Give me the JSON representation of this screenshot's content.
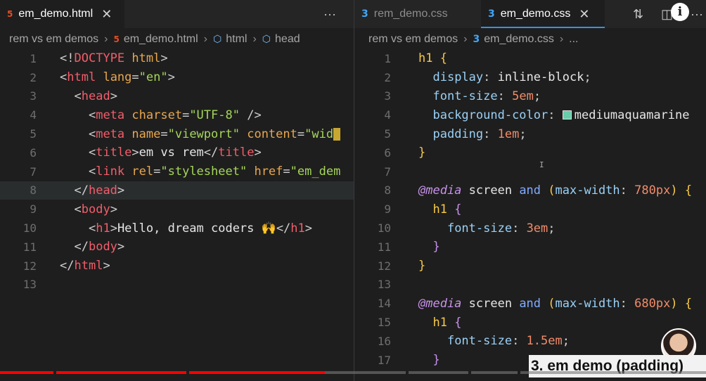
{
  "left": {
    "tab": {
      "title": "em_demo.html",
      "close_icon": "close-icon",
      "more_label": "···"
    },
    "breadcrumb": [
      "rem vs em demos",
      "em_demo.html",
      "html",
      "head"
    ],
    "current_line": 8,
    "lines": [
      {
        "n": "1",
        "tokens": [
          [
            "t-punct",
            "<!"
          ],
          [
            "t-tag",
            "DOCTYPE"
          ],
          [
            "t-text",
            " "
          ],
          [
            "t-attr",
            "html"
          ],
          [
            "t-punct",
            ">"
          ]
        ]
      },
      {
        "n": "2",
        "tokens": [
          [
            "t-punct",
            "<"
          ],
          [
            "t-tag",
            "html"
          ],
          [
            "t-text",
            " "
          ],
          [
            "t-attr",
            "lang"
          ],
          [
            "t-punct",
            "="
          ],
          [
            "t-str",
            "\"en\""
          ],
          [
            "t-punct",
            ">"
          ]
        ]
      },
      {
        "n": "3",
        "tokens": [
          [
            "t-text",
            "  "
          ],
          [
            "t-punct",
            "<"
          ],
          [
            "t-tag",
            "head"
          ],
          [
            "t-punct",
            ">"
          ]
        ]
      },
      {
        "n": "4",
        "tokens": [
          [
            "t-text",
            "    "
          ],
          [
            "t-punct",
            "<"
          ],
          [
            "t-tag",
            "meta"
          ],
          [
            "t-text",
            " "
          ],
          [
            "t-attr",
            "charset"
          ],
          [
            "t-punct",
            "="
          ],
          [
            "t-str",
            "\"UTF-8\""
          ],
          [
            "t-text",
            " "
          ],
          [
            "t-punct",
            "/>"
          ]
        ]
      },
      {
        "n": "5",
        "tokens": [
          [
            "t-text",
            "    "
          ],
          [
            "t-punct",
            "<"
          ],
          [
            "t-tag",
            "meta"
          ],
          [
            "t-text",
            " "
          ],
          [
            "t-attr",
            "name"
          ],
          [
            "t-punct",
            "="
          ],
          [
            "t-str",
            "\"viewport\""
          ],
          [
            "t-text",
            " "
          ],
          [
            "t-attr",
            "content"
          ],
          [
            "t-punct",
            "="
          ],
          [
            "t-str",
            "\"wid"
          ]
        ]
      },
      {
        "n": "6",
        "tokens": [
          [
            "t-text",
            "    "
          ],
          [
            "t-punct",
            "<"
          ],
          [
            "t-tag",
            "title"
          ],
          [
            "t-punct",
            ">"
          ],
          [
            "t-text",
            "em vs rem"
          ],
          [
            "t-punct",
            "</"
          ],
          [
            "t-tag",
            "title"
          ],
          [
            "t-punct",
            ">"
          ]
        ]
      },
      {
        "n": "7",
        "tokens": [
          [
            "t-text",
            "    "
          ],
          [
            "t-punct",
            "<"
          ],
          [
            "t-tag",
            "link"
          ],
          [
            "t-text",
            " "
          ],
          [
            "t-attr",
            "rel"
          ],
          [
            "t-punct",
            "="
          ],
          [
            "t-str",
            "\"stylesheet\""
          ],
          [
            "t-text",
            " "
          ],
          [
            "t-attr",
            "href"
          ],
          [
            "t-punct",
            "="
          ],
          [
            "t-str",
            "\"em_dem"
          ]
        ]
      },
      {
        "n": "8",
        "tokens": [
          [
            "t-text",
            "  "
          ],
          [
            "t-punct",
            "</"
          ],
          [
            "t-tag",
            "head"
          ],
          [
            "t-punct",
            ">"
          ]
        ]
      },
      {
        "n": "9",
        "tokens": [
          [
            "t-text",
            "  "
          ],
          [
            "t-punct",
            "<"
          ],
          [
            "t-tag",
            "body"
          ],
          [
            "t-punct",
            ">"
          ]
        ]
      },
      {
        "n": "10",
        "tokens": [
          [
            "t-text",
            "    "
          ],
          [
            "t-punct",
            "<"
          ],
          [
            "t-tag",
            "h1"
          ],
          [
            "t-punct",
            ">"
          ],
          [
            "t-text",
            "Hello, dream coders 🙌"
          ],
          [
            "t-punct",
            "</"
          ],
          [
            "t-tag",
            "h1"
          ],
          [
            "t-punct",
            ">"
          ]
        ]
      },
      {
        "n": "11",
        "tokens": [
          [
            "t-text",
            "  "
          ],
          [
            "t-punct",
            "</"
          ],
          [
            "t-tag",
            "body"
          ],
          [
            "t-punct",
            ">"
          ]
        ]
      },
      {
        "n": "12",
        "tokens": [
          [
            "t-punct",
            "</"
          ],
          [
            "t-tag",
            "html"
          ],
          [
            "t-punct",
            ">"
          ]
        ]
      },
      {
        "n": "13",
        "tokens": []
      }
    ]
  },
  "right": {
    "tabs": [
      {
        "title": "rem_demo.css",
        "active": false
      },
      {
        "title": "em_demo.css",
        "active": true,
        "close_icon": "close-icon"
      }
    ],
    "breadcrumb": [
      "rem vs em demos",
      "em_demo.css",
      "..."
    ],
    "swatch_color": "#66cdaa",
    "lines": [
      {
        "n": "1",
        "tokens": [
          [
            "t-sel",
            "h1"
          ],
          [
            "t-text",
            " "
          ],
          [
            "t-brace",
            "{"
          ]
        ]
      },
      {
        "n": "2",
        "tokens": [
          [
            "t-text",
            "  "
          ],
          [
            "t-prop",
            "display"
          ],
          [
            "t-punct",
            ": "
          ],
          [
            "t-val",
            "inline-block"
          ],
          [
            "t-punct",
            ";"
          ]
        ]
      },
      {
        "n": "3",
        "tokens": [
          [
            "t-text",
            "  "
          ],
          [
            "t-prop",
            "font-size"
          ],
          [
            "t-punct",
            ": "
          ],
          [
            "t-num",
            "5em"
          ],
          [
            "t-punct",
            ";"
          ]
        ]
      },
      {
        "n": "4",
        "tokens": [
          [
            "t-text",
            "  "
          ],
          [
            "t-prop",
            "background-color"
          ],
          [
            "t-punct",
            ": "
          ],
          [
            "swatch",
            ""
          ],
          [
            "t-val",
            "mediumaquamarine"
          ]
        ]
      },
      {
        "n": "5",
        "tokens": [
          [
            "t-text",
            "  "
          ],
          [
            "t-prop",
            "padding"
          ],
          [
            "t-punct",
            ": "
          ],
          [
            "t-num",
            "1em"
          ],
          [
            "t-punct",
            ";"
          ]
        ]
      },
      {
        "n": "6",
        "tokens": [
          [
            "t-brace",
            "}"
          ]
        ]
      },
      {
        "n": "7",
        "tokens": []
      },
      {
        "n": "8",
        "tokens": [
          [
            "t-kw",
            "@media"
          ],
          [
            "t-text",
            " screen "
          ],
          [
            "t-and",
            "and"
          ],
          [
            "t-text",
            " "
          ],
          [
            "t-brace",
            "("
          ],
          [
            "t-prop",
            "max-width"
          ],
          [
            "t-punct",
            ": "
          ],
          [
            "t-num",
            "780px"
          ],
          [
            "t-brace",
            ")"
          ],
          [
            "t-text",
            " "
          ],
          [
            "t-brace",
            "{"
          ]
        ]
      },
      {
        "n": "9",
        "tokens": [
          [
            "t-text",
            "  "
          ],
          [
            "t-sel",
            "h1"
          ],
          [
            "t-text",
            " "
          ],
          [
            "t-brace2",
            "{"
          ]
        ]
      },
      {
        "n": "10",
        "tokens": [
          [
            "t-text",
            "    "
          ],
          [
            "t-prop",
            "font-size"
          ],
          [
            "t-punct",
            ": "
          ],
          [
            "t-num",
            "3em"
          ],
          [
            "t-punct",
            ";"
          ]
        ]
      },
      {
        "n": "11",
        "tokens": [
          [
            "t-text",
            "  "
          ],
          [
            "t-brace2",
            "}"
          ]
        ]
      },
      {
        "n": "12",
        "tokens": [
          [
            "t-brace",
            "}"
          ]
        ]
      },
      {
        "n": "13",
        "tokens": []
      },
      {
        "n": "14",
        "tokens": [
          [
            "t-kw",
            "@media"
          ],
          [
            "t-text",
            " screen "
          ],
          [
            "t-and",
            "and"
          ],
          [
            "t-text",
            " "
          ],
          [
            "t-brace",
            "("
          ],
          [
            "t-prop",
            "max-width"
          ],
          [
            "t-punct",
            ": "
          ],
          [
            "t-num",
            "680px"
          ],
          [
            "t-brace",
            ")"
          ],
          [
            "t-text",
            " "
          ],
          [
            "t-brace",
            "{"
          ]
        ]
      },
      {
        "n": "15",
        "tokens": [
          [
            "t-text",
            "  "
          ],
          [
            "t-sel",
            "h1"
          ],
          [
            "t-text",
            " "
          ],
          [
            "t-brace2",
            "{"
          ]
        ]
      },
      {
        "n": "16",
        "tokens": [
          [
            "t-text",
            "    "
          ],
          [
            "t-prop",
            "font-size"
          ],
          [
            "t-punct",
            ": "
          ],
          [
            "t-num",
            "1.5em"
          ],
          [
            "t-punct",
            ";"
          ]
        ]
      },
      {
        "n": "17",
        "tokens": [
          [
            "t-text",
            "  "
          ],
          [
            "t-brace2",
            "}"
          ]
        ]
      }
    ]
  },
  "toolbar": {
    "compare_icon": "source-control-icon",
    "split_icon": "split-editor-icon",
    "info_label": "i",
    "more_label": "···"
  },
  "video": {
    "caption": "3. em demo (padding)",
    "progress_fraction": 0.46
  }
}
